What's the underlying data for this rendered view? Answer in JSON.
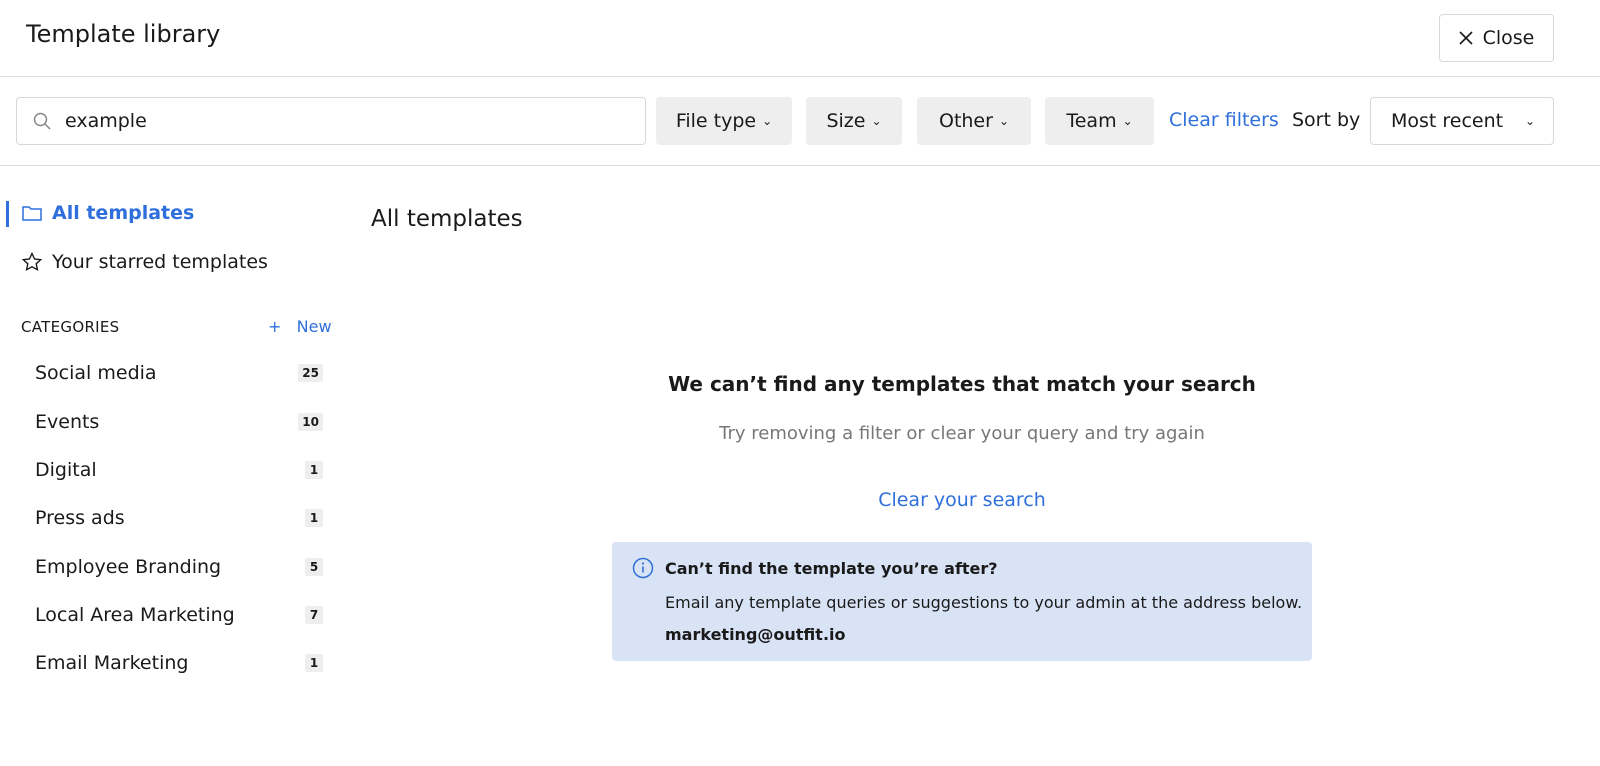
{
  "header": {
    "title": "Template library",
    "close_label": "Close"
  },
  "filters": {
    "search_value": "example",
    "buttons": [
      "File type",
      "Size",
      "Other",
      "Team"
    ],
    "clear_filters": "Clear filters",
    "sort_by_label": "Sort by",
    "sort_value": "Most recent"
  },
  "sidebar": {
    "all_templates": "All templates",
    "starred": "Your starred templates",
    "categories_heading": "CATEGORIES",
    "new_label": "New",
    "categories": [
      {
        "label": "Social media",
        "count": "25"
      },
      {
        "label": "Events",
        "count": "10"
      },
      {
        "label": "Digital",
        "count": "1"
      },
      {
        "label": "Press ads",
        "count": "1"
      },
      {
        "label": "Employee Branding",
        "count": "5"
      },
      {
        "label": "Local Area Marketing",
        "count": "7"
      },
      {
        "label": "Email Marketing",
        "count": "1"
      }
    ]
  },
  "main": {
    "title": "All templates",
    "empty_heading": "We can’t find any templates that match your search",
    "empty_sub": "Try removing a filter or clear your query and try again",
    "clear_search": "Clear your search",
    "info": {
      "heading": "Can’t find the template you’re after?",
      "body": "Email any template queries or suggestions to your admin at the address below.",
      "email": "marketing@outfit.io"
    }
  },
  "colors": {
    "accent": "#2f6fdc",
    "info_bg": "#d9e3f6",
    "chip_bg": "#eeeeee"
  }
}
